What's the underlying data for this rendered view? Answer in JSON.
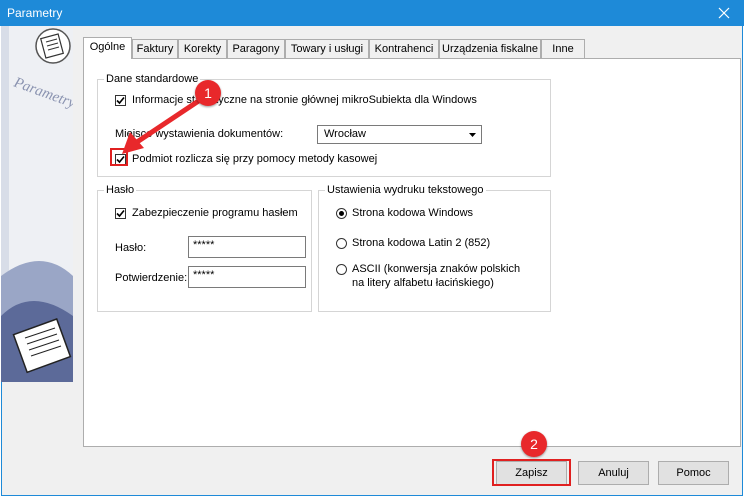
{
  "window": {
    "title": "Parametry"
  },
  "tabs": [
    {
      "label": "Ogólne"
    },
    {
      "label": "Faktury"
    },
    {
      "label": "Korekty"
    },
    {
      "label": "Paragony"
    },
    {
      "label": "Towary i usługi"
    },
    {
      "label": "Kontrahenci"
    },
    {
      "label": "Urządzenia fiskalne"
    },
    {
      "label": "Inne"
    }
  ],
  "dane_standardowe": {
    "legend": "Dane standardowe",
    "info_checkbox_label": "Informacje statystyczne na stronie głównej mikroSubiekta dla Windows",
    "info_checked": true,
    "miejsce_label": "Miejsce wystawienia dokumentów:",
    "miejsce_value": "Wrocław",
    "kasowa_label": "Podmiot rozlicza się przy pomocy metody kasowej",
    "kasowa_checked": true
  },
  "haslo": {
    "legend": "Hasło",
    "zabezpieczenie_label": "Zabezpieczenie programu hasłem",
    "zabezpieczenie_checked": true,
    "haslo_label": "Hasło:",
    "haslo_value": "*****",
    "potwierdzenie_label": "Potwierdzenie:",
    "potwierdzenie_value": "*****"
  },
  "wydruk": {
    "legend": "Ustawienia wydruku tekstowego",
    "options": [
      {
        "label": "Strona kodowa Windows",
        "selected": true
      },
      {
        "label": "Strona kodowa Latin 2 (852)",
        "selected": false
      },
      {
        "label_line1": "ASCII (konwersja znaków polskich",
        "label_line2": "na litery alfabetu łacińskiego)",
        "selected": false
      }
    ]
  },
  "buttons": {
    "zapisz": "Zapisz",
    "anuluj": "Anuluj",
    "pomoc": "Pomoc"
  },
  "annotations": {
    "badge1": "1",
    "badge2": "2",
    "color": "#e8282b"
  },
  "sidebar": {
    "label": "Parametry"
  }
}
